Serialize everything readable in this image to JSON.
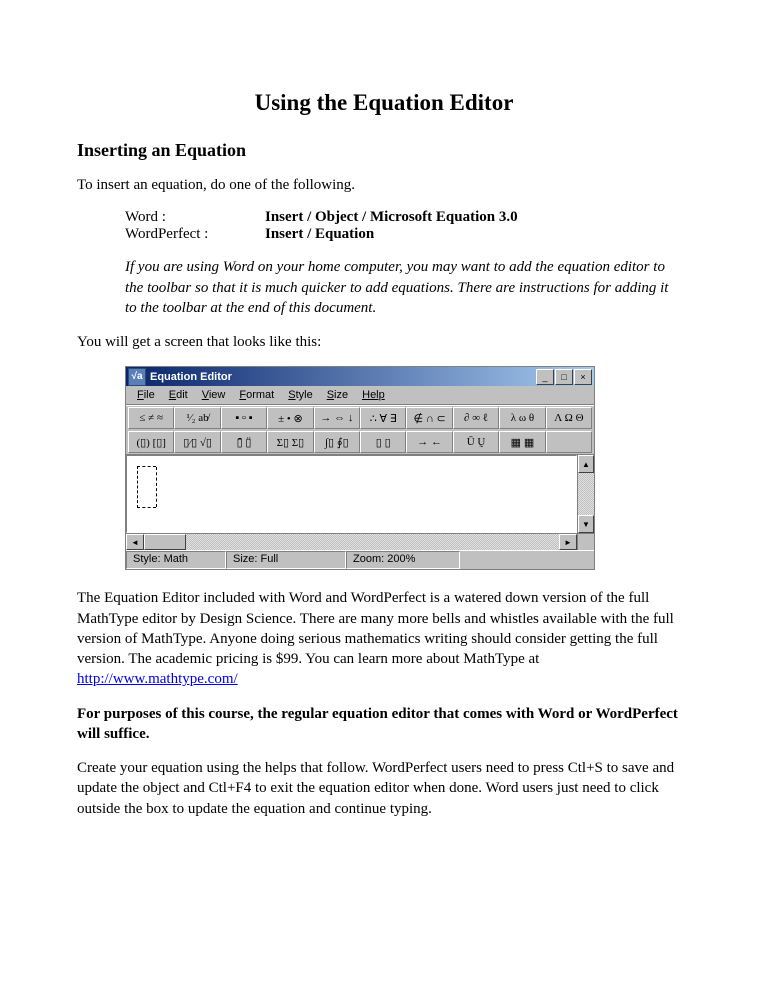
{
  "title": "Using the Equation Editor",
  "heading": "Inserting an Equation",
  "intro": "To insert an equation, do one of the following.",
  "apps": {
    "word_label": "Word :",
    "word_path": "Insert / Object / Microsoft Equation 3.0",
    "wp_label": "WordPerfect :",
    "wp_path": "Insert / Equation"
  },
  "note": "If you are using Word on your home computer, you may want to add the equation editor to the toolbar so that it is much quicker to add equations.  There are instructions for adding it to the toolbar at the end of this document.",
  "screen_intro": "You will get a screen that looks like this:",
  "eq_window": {
    "icon_glyph": "√a",
    "title": "Equation Editor",
    "buttons": {
      "min": "_",
      "max": "□",
      "close": "×"
    },
    "menu": [
      "File",
      "Edit",
      "View",
      "Format",
      "Style",
      "Size"
    ],
    "menu_help": "Help",
    "toolbar_row1": [
      "≤ ≠ ≈",
      "¹⁄₂ ab̸",
      "▪ ▫ ▪",
      "± • ⊗",
      "→ ⇔ ↓",
      "∴ ∀ ∃",
      "∉ ∩ ⊂",
      "∂ ∞ ℓ",
      "λ ω θ",
      "Λ Ω Θ"
    ],
    "toolbar_row2": [
      "(▯) [▯]",
      "▯⁄▯ √▯",
      "▯̄ ▯̈",
      "Σ▯ Σ▯",
      "∫▯ ∮▯",
      "▯ ▯",
      "→ ←",
      "Ū Ṵ",
      "▦ ▦",
      ""
    ],
    "status": {
      "style": "Style: Math",
      "size": "Size: Full",
      "zoom": "Zoom: 200%"
    }
  },
  "para1_a": "The Equation Editor included with Word and WordPerfect is a watered down version of the full MathType editor by Design Science.   There are many more bells and whistles available with the full version of MathType.  Anyone doing serious mathematics writing should consider getting the full version.  The academic pricing is $99.  You can learn more about MathType at ",
  "link": "http://www.mathtype.com/",
  "para2": "For purposes of this course, the regular equation editor that comes with Word or WordPerfect will suffice.",
  "para3": "Create your equation using the helps that follow.  WordPerfect users need to press Ctl+S to save and update the object and Ctl+F4 to exit the equation editor when done.  Word users just need to click outside the box to update the equation and continue typing."
}
